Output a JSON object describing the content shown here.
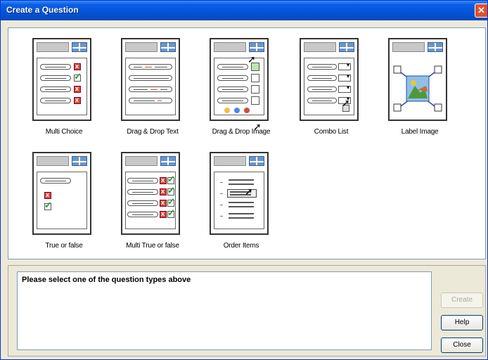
{
  "window": {
    "title": "Create a Question",
    "close_glyph": "✕"
  },
  "question_types": [
    {
      "label": "Multi Choice"
    },
    {
      "label": "Drag & Drop Text"
    },
    {
      "label": "Drag & Drop Image"
    },
    {
      "label": "Combo List"
    },
    {
      "label": "Label Image"
    },
    {
      "label": "True or false"
    },
    {
      "label": "Multi True or false"
    },
    {
      "label": "Order Items"
    }
  ],
  "description": {
    "text": "Please select one of the question types above"
  },
  "buttons": {
    "create": "Create",
    "help": "Help",
    "close": "Close"
  },
  "icons": {
    "check": "check-icon",
    "cross": "cross-icon",
    "cursor": "mouse-pointer-icon"
  },
  "colors": {
    "accent": "#0553d6",
    "wrong": "#d04c3a",
    "right": "#2b9a2b"
  }
}
